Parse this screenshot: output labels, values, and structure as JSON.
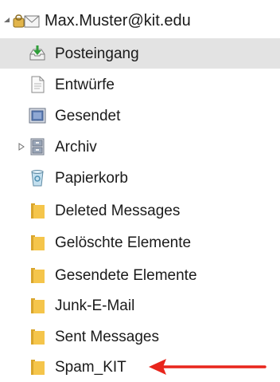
{
  "account": {
    "label": "Max.Muster@kit.edu",
    "expander_icon": "triangle-open-icon",
    "icon": "mail-account-icon"
  },
  "folders": [
    {
      "label": "Posteingang",
      "icon": "inbox-icon",
      "selected": true
    },
    {
      "label": "Entwürfe",
      "icon": "drafts-icon"
    },
    {
      "label": "Gesendet",
      "icon": "sent-icon"
    },
    {
      "label": "Archiv",
      "icon": "archive-icon",
      "expander_icon": "triangle-closed-icon"
    },
    {
      "label": "Papierkorb",
      "icon": "trash-icon"
    },
    {
      "label": "Deleted Messages",
      "icon": "folder-icon"
    },
    {
      "label": "Gelöschte Elemente",
      "icon": "folder-icon"
    },
    {
      "label": "Gesendete Elemente",
      "icon": "folder-icon"
    },
    {
      "label": "Junk-E-Mail",
      "icon": "folder-icon"
    },
    {
      "label": "Sent Messages",
      "icon": "folder-icon"
    },
    {
      "label": "Spam_KIT",
      "icon": "folder-icon"
    }
  ],
  "annotation": {
    "icon": "red-arrow-icon",
    "color": "#e8251c"
  },
  "colors": {
    "selected_background": "#e3e3e3",
    "folder_yellow": "#f5c54b",
    "folder_yellow_dark": "#d9a52d"
  }
}
